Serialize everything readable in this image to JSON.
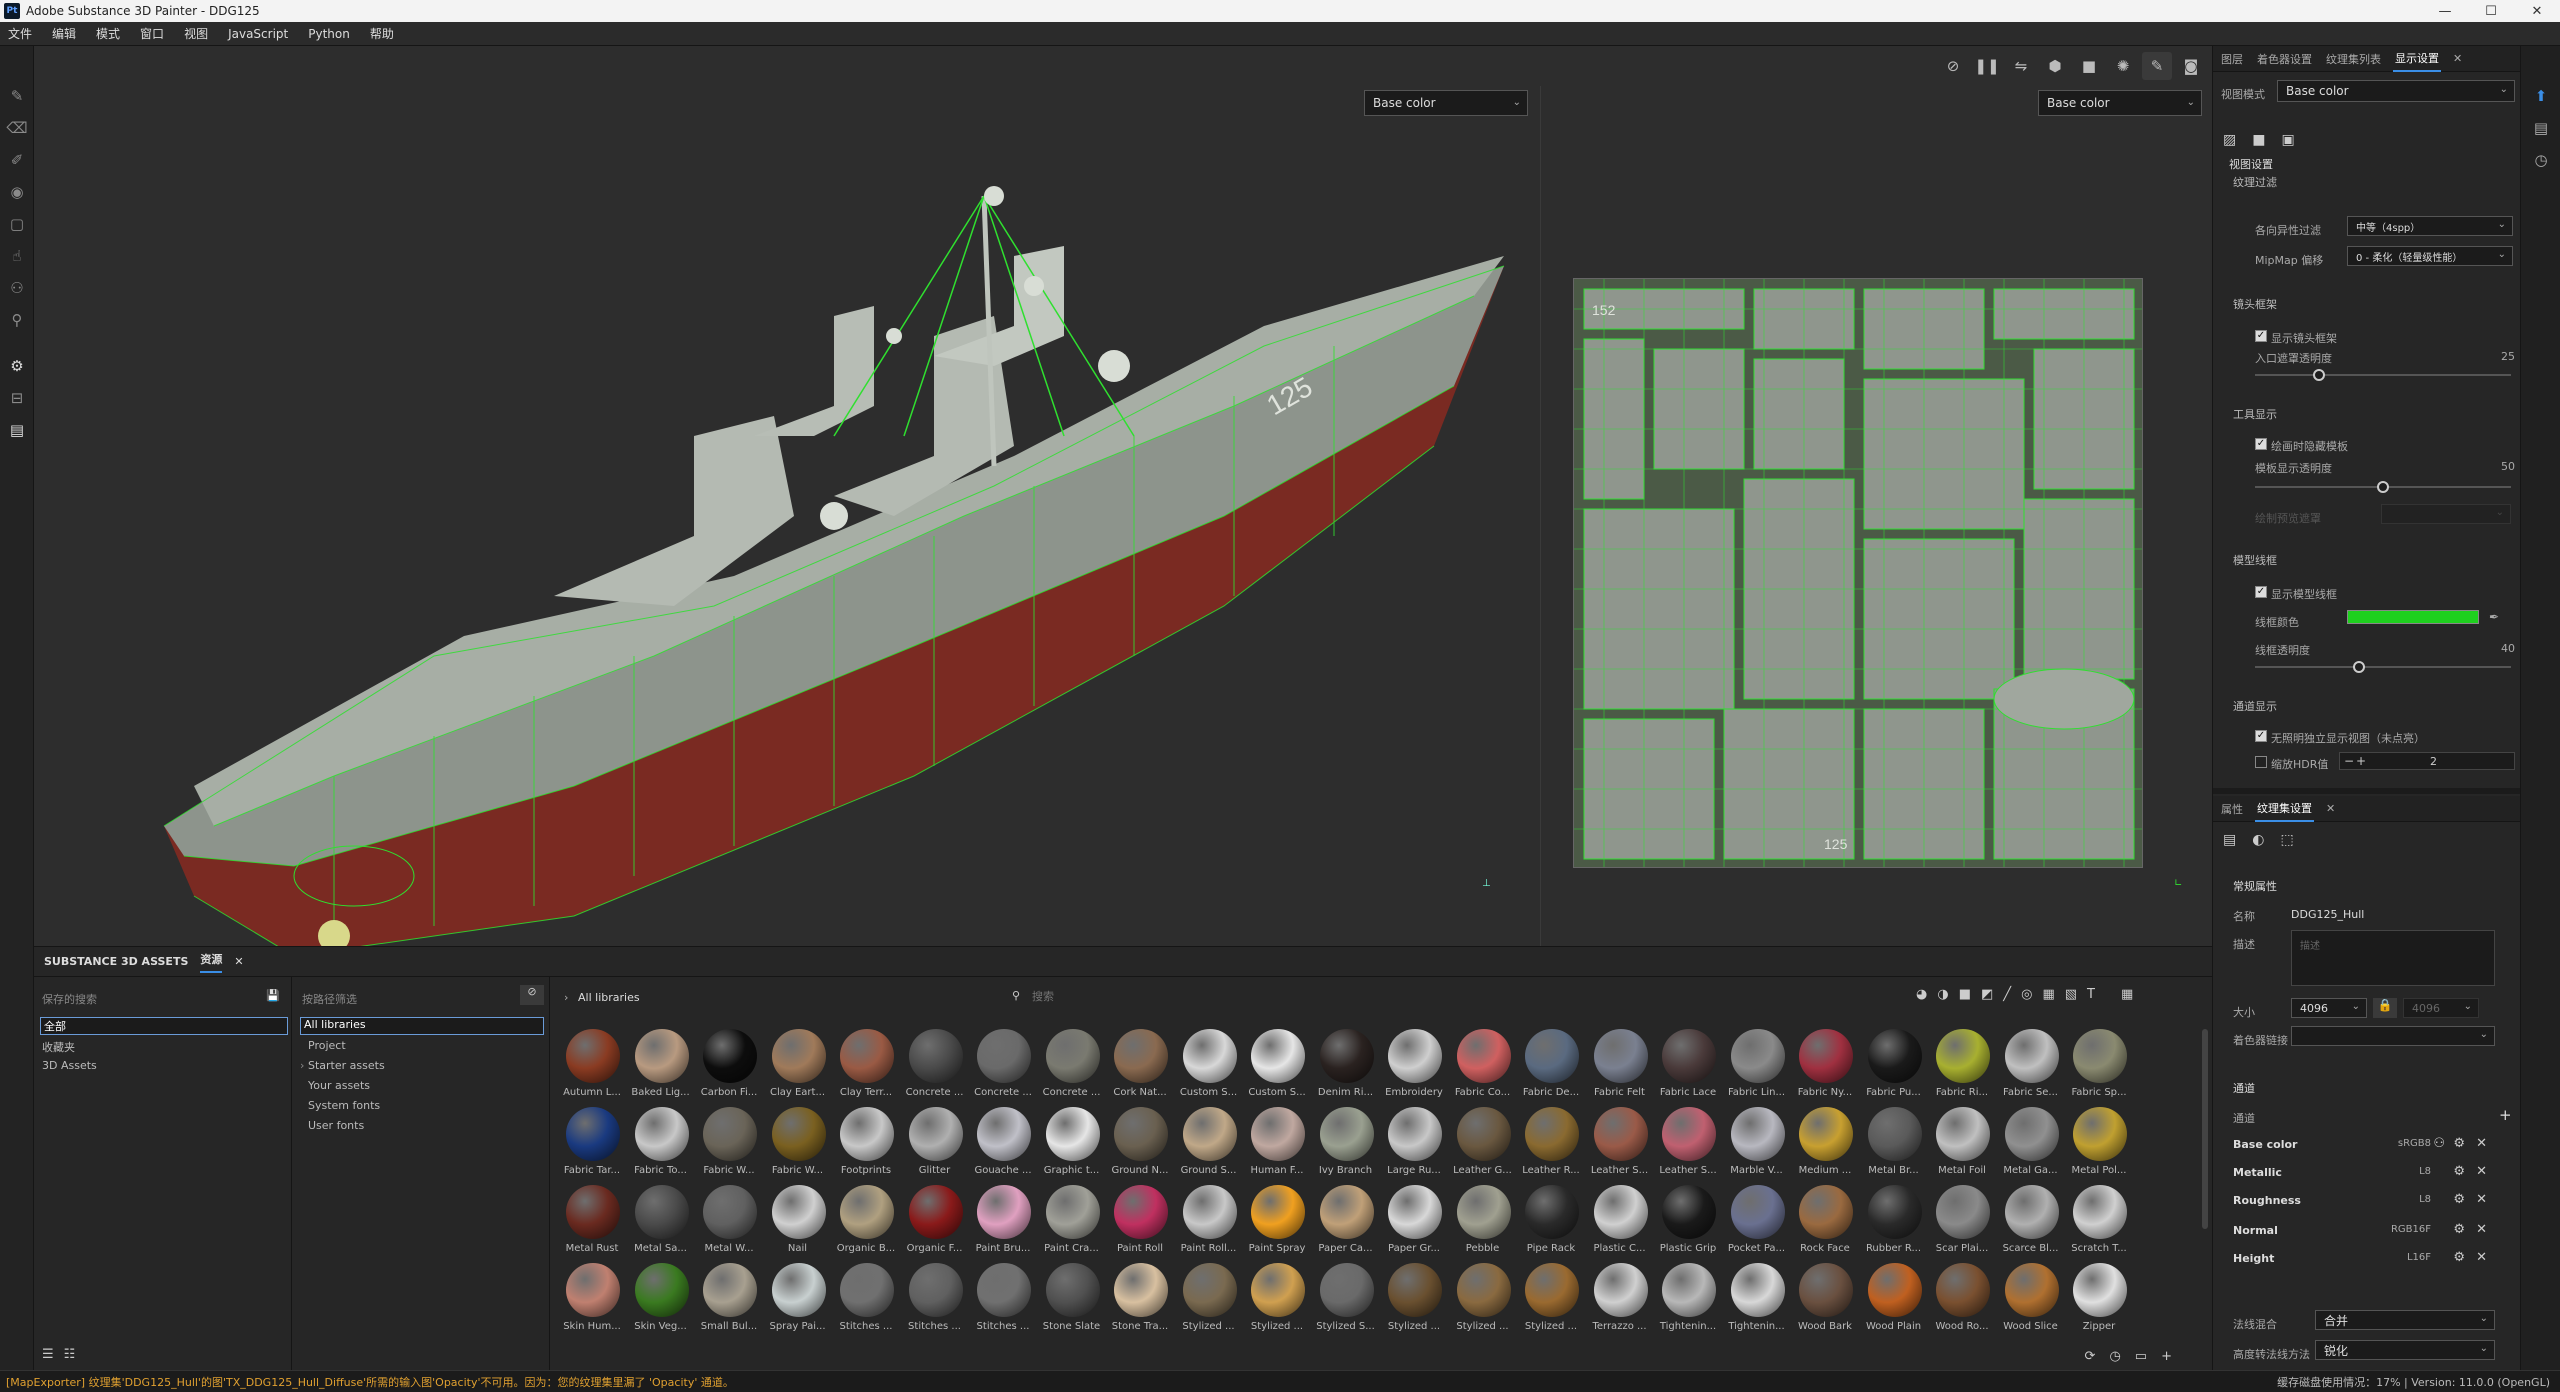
{
  "window": {
    "title": "Adobe Substance 3D Painter - DDG125",
    "logo": "Pt"
  },
  "menu": [
    "文件",
    "编辑",
    "模式",
    "窗口",
    "视图",
    "JavaScript",
    "Python",
    "帮助"
  ],
  "viewport": {
    "left_channel": "Base color",
    "right_channel": "Base color",
    "uv_label_top": "152",
    "uv_label_bottom": "125"
  },
  "right_panel": {
    "tabs": [
      "图层",
      "着色器设置",
      "纹理集列表",
      "显示设置"
    ],
    "view_mode_label": "视图模式",
    "view_mode_value": "Base color",
    "section_view": "视图设置",
    "texture_filter": "纹理过滤",
    "aniso_label": "各向异性过滤",
    "aniso_value": "中等（4spp）",
    "mipmap_label": "MipMap 偏移",
    "mipmap_value": "0 - 柔化（轻量级性能）",
    "camera_frame": "镜头框架",
    "show_camera_frame": "显示镜头框架",
    "entry_opacity_label": "入口遮罩透明度",
    "entry_opacity_value": "25",
    "tool_display": "工具显示",
    "hide_stencil": "绘画时隐藏模板",
    "stencil_opacity_label": "模板显示透明度",
    "stencil_opacity_value": "50",
    "disabled_row": "绘制预览遮罩",
    "model_wireframe": "模型线框",
    "show_wireframe": "显示模型线框",
    "wire_color_label": "线框颜色",
    "wire_color": "#1ed01e",
    "wire_opacity_label": "线框透明度",
    "wire_opacity_value": "40",
    "channel_display": "通道显示",
    "no_alpha": "无照明独立显示视图（未点亮）",
    "hdr_label": "缩放HDR值",
    "hdr_value": "2",
    "tabs2": [
      "属性",
      "纹理集设置"
    ],
    "general": "常规属性",
    "name_label": "名称",
    "name_value": "DDG125_Hull",
    "desc_label": "描述",
    "desc_placeholder": "描述",
    "size_label": "大小",
    "size_value": "4096",
    "size_value2": "4096",
    "color_profile_label": "着色器链接",
    "channels_title": "通道",
    "channels_label": "通道",
    "channels": [
      {
        "name": "Base color",
        "format": "sRGB8"
      },
      {
        "name": "Metallic",
        "format": "L8"
      },
      {
        "name": "Roughness",
        "format": "L8"
      },
      {
        "name": "Normal",
        "format": "RGB16F"
      },
      {
        "name": "Height",
        "format": "L16F"
      }
    ],
    "normal_mix_label": "法线混合",
    "normal_mix_value": "合并",
    "ao_label": "高度转法线方法",
    "ao_value": "锐化"
  },
  "assets": {
    "tab_title": "SUBSTANCE 3D ASSETS",
    "tab_res": "资源",
    "saved_search": "保存的搜索",
    "filter_label": "按路径筛选",
    "left_items": [
      "全部",
      "收藏夹",
      "3D Assets"
    ],
    "libraries": [
      "All libraries",
      "Project",
      "Starter assets",
      "Your assets",
      "System fonts",
      "User fonts"
    ],
    "breadcrumb": "All libraries",
    "search_placeholder": "搜索",
    "materials": [
      "Autumn L...",
      "Baked Lig...",
      "Carbon Fi...",
      "Clay Eart...",
      "Clay Terr...",
      "Concrete ...",
      "Concrete ...",
      "Concrete ...",
      "Cork Nat...",
      "Custom S...",
      "Custom S...",
      "Denim Ri...",
      "Embroidery",
      "Fabric Co...",
      "Fabric De...",
      "Fabric Felt",
      "Fabric Lace",
      "Fabric Lin...",
      "Fabric Ny...",
      "Fabric Pu...",
      "Fabric Ri...",
      "Fabric Se...",
      "Fabric Sp...",
      "Fabric Tar...",
      "Fabric To...",
      "Fabric W...",
      "Fabric W...",
      "Footprints",
      "Glitter",
      "Gouache ...",
      "Graphic t...",
      "Ground N...",
      "Ground S...",
      "Human F...",
      "Ivy Branch",
      "Large Ru...",
      "Leather G...",
      "Leather R...",
      "Leather S...",
      "Leather S...",
      "Marble V...",
      "Medium ...",
      "Metal Br...",
      "Metal Foil",
      "Metal Ga...",
      "Metal Pol...",
      "Metal Rust",
      "Metal Sa...",
      "Metal W...",
      "Nail",
      "Organic B...",
      "Organic F...",
      "Paint Bru...",
      "Paint Cra...",
      "Paint Roll",
      "Paint Roll...",
      "Paint Spray",
      "Paper Ca...",
      "Paper Gr...",
      "Pebble",
      "Pipe Rack",
      "Plastic C...",
      "Plastic Grip",
      "Pocket Pa...",
      "Rock Face",
      "Rubber R...",
      "Scar Plai...",
      "Scarce Bl...",
      "Scratch T...",
      "Skin Hum...",
      "Skin Veg...",
      "Small Bul...",
      "Spray Pai...",
      "Stitches ...",
      "Stitches ...",
      "Stitches ...",
      "Stone Slate",
      "Stone Tra...",
      "Stylized ...",
      "Stylized ...",
      "Stylized S...",
      "Stylized ...",
      "Stylized ...",
      "Stylized ...",
      "Terrazzo ...",
      "Tightenin...",
      "Tightenin...",
      "Wood Bark",
      "Wood Plain",
      "Wood Ro...",
      "Wood Slice",
      "Zipper"
    ],
    "colors": [
      "#8a3b22",
      "#b89a80",
      "#0d0d0d",
      "#a07a5a",
      "#9a5a44",
      "#4a4a4a",
      "#6a6a6a",
      "#7a7a70",
      "#8a6a50",
      "#d8d8d8",
      "#e6e6e6",
      "#2a2220",
      "#cfcfcf",
      "#d06060",
      "#5a6a80",
      "#7a8090",
      "#4a3a3a",
      "#8a8a8a",
      "#a03040",
      "#1a1a1a",
      "#a8b030",
      "#c0c0c0",
      "#8a8a70",
      "#1a3a80",
      "#c8c8c8",
      "#6a6458",
      "#7a6020",
      "#c8c8c8",
      "#b0b0b0",
      "#c0c0c8",
      "#e6e6e6",
      "#6a6050",
      "#c0a888",
      "#c0a8a0",
      "#9aa090",
      "#c8c8c8",
      "#6a5840",
      "#8a6a30",
      "#9a5a48",
      "#c06070",
      "#b8b8c0",
      "#c8a030",
      "#5a5a5a",
      "#c0c0c0",
      "#909090",
      "#c0a030",
      "#6a2a20",
      "#4a4a4a",
      "#606060",
      "#d0d0d0",
      "#b0a080",
      "#8a1a1a",
      "#e0a0c0",
      "#a0a098",
      "#c03060",
      "#c8c8c8",
      "#f0a020",
      "#c0a078",
      "#d8d8d8",
      "#a0a090",
      "#2a2a2a",
      "#d0d0d0",
      "#1a1a1a",
      "#6a7090",
      "#9a6a40",
      "#2a2a2a",
      "#8a8a8a",
      "#b0b0b0",
      "#d0d0d0",
      "#c08070",
      "#3a7a20",
      "#a8a090",
      "#c8d0d0",
      "#707070",
      "#606060",
      "#707070",
      "#505050",
      "#d8c0a0",
      "#7a6a50",
      "#d0a050",
      "#6a6a6a",
      "#6a5030",
      "#8a6a40",
      "#9a6a30",
      "#d0d0d0",
      "#b8b8b8",
      "#d8d8d8",
      "#6a5040",
      "#c06020",
      "#7a5030",
      "#b07030",
      "#e0e0e0"
    ]
  },
  "status": {
    "error": "[MapExporter] 纹理集'DDG125_Hull'的图'TX_DDG125_Hull_Diffuse'所需的输入图'Opacity'不可用。因为：您的纹理集里漏了 'Opacity' 通道。",
    "right": "缓存磁盘使用情况：17% | Version: 11.0.0 (OpenGL)"
  }
}
